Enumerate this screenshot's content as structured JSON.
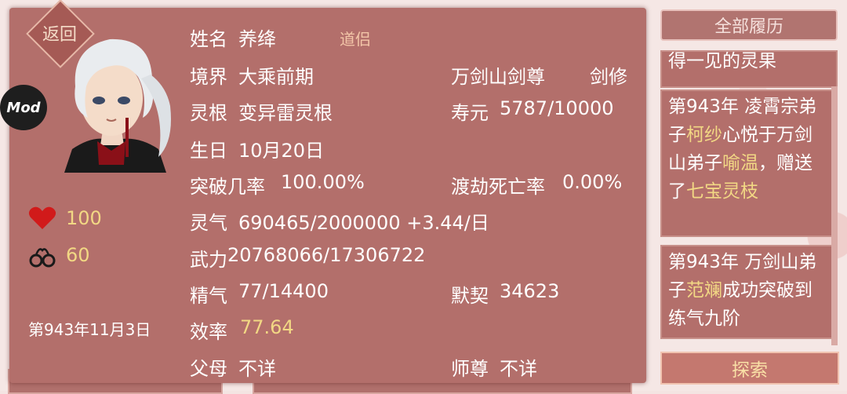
{
  "profile": {
    "back_label": "返回",
    "mod_badge": "Mod",
    "name_label": "姓名",
    "name_value": "养绛",
    "dao_tag": "道侣",
    "realm_label": "境界",
    "realm_value": "大乘前期",
    "sect_title": "万剑山剑尊",
    "class_label": "剑修",
    "root_label": "灵根",
    "root_value": "变异雷灵根",
    "lifespan_label": "寿元",
    "lifespan_value": "5787/10000",
    "birthday_label": "生日",
    "birthday_value": "10月20日",
    "breakthrough_label": "突破几率",
    "breakthrough_value": "100.00%",
    "tribulation_label": "渡劫死亡率",
    "tribulation_value": "0.00%",
    "qi_label": "灵气",
    "qi_value": "690465/2000000 +3.44/日",
    "power_label": "武力",
    "power_value": "20768066/17306722",
    "essence_label": "精气",
    "essence_value": "77/14400",
    "rapport_label": "默契",
    "rapport_value": "34623",
    "efficiency_label": "效率",
    "efficiency_value": "77.64",
    "parents_label": "父母",
    "parents_value": "不详",
    "master_label": "师尊",
    "master_value": "不详",
    "hp_value": "100",
    "bond_value": "60",
    "date": "第943年11月3日"
  },
  "sidebar": {
    "history_button": "全部履历",
    "partial_card_text": "得一见的灵果",
    "event1": {
      "p1": "第943年 凌霄宗弟子",
      "n1": "柯纱",
      "p2": "心悦于万剑山弟子",
      "n2": "喻温",
      "p3": "，赠送了",
      "item": "七宝灵枝"
    },
    "event2": {
      "p1": "第943年 万剑山弟子",
      "n1": "范斓",
      "p2": "成功突破到练气九阶"
    },
    "explore_button": "探索"
  },
  "colors": {
    "panel": "#b36f6b",
    "gold_text": "#f2d884",
    "heart": "#d11a1a"
  },
  "icons": [
    "heart-icon",
    "handcuffs-icon"
  ]
}
